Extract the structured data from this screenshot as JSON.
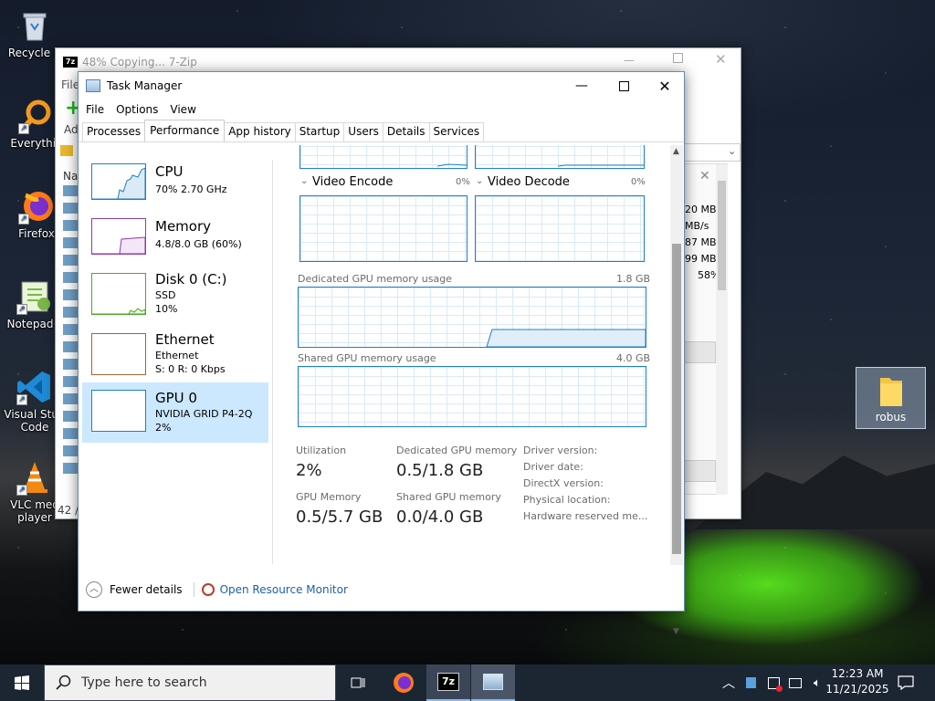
{
  "desktop": {
    "icons": [
      {
        "label": "Recycle B"
      },
      {
        "label": "Everythin"
      },
      {
        "label": "Firefox"
      },
      {
        "label": "Notepad+"
      },
      {
        "label": "Visual Stud Code"
      },
      {
        "label": "VLC med player"
      }
    ],
    "folder": {
      "label": "robus"
    }
  },
  "zip": {
    "title": "48% Copying... 7-Zip",
    "menu_file": "File",
    "add_label": "Ad",
    "list_header": "Nar",
    "status": "42 /",
    "stats": [
      "20 MB",
      "MB/s",
      "87 MB",
      "99 MB",
      "58%"
    ]
  },
  "tm": {
    "title": "Task Manager",
    "menu": [
      "File",
      "Options",
      "View"
    ],
    "tabs": [
      "Processes",
      "Performance",
      "App history",
      "Startup",
      "Users",
      "Details",
      "Services"
    ],
    "resources": [
      {
        "title": "CPU",
        "sub1": "70% 2.70 GHz",
        "sub2": "",
        "sub3": "",
        "color": "#1f7fc7"
      },
      {
        "title": "Memory",
        "sub1": "4.8/8.0 GB (60%)",
        "sub2": "",
        "sub3": "",
        "color": "#8b3da8"
      },
      {
        "title": "Disk 0 (C:)",
        "sub1": "SSD",
        "sub2": "10%",
        "sub3": "",
        "color": "#4da82b"
      },
      {
        "title": "Ethernet",
        "sub1": "Ethernet",
        "sub2": "S: 0 R: 0 Kbps",
        "sub3": "",
        "color": "#a6642b"
      },
      {
        "title": "GPU 0",
        "sub1": "NVIDIA GRID P4-2Q",
        "sub2": "2%",
        "sub3": "",
        "color": "#1f7fc7"
      }
    ],
    "engines": [
      {
        "name": "Video Encode",
        "pct": "0%"
      },
      {
        "name": "Video Decode",
        "pct": "0%"
      }
    ],
    "dedicated": {
      "label": "Dedicated GPU memory usage",
      "max": "1.8 GB"
    },
    "shared": {
      "label": "Shared GPU memory usage",
      "max": "4.0 GB"
    },
    "stats": {
      "utilization_label": "Utilization",
      "utilization": "2%",
      "dedicated_label": "Dedicated GPU memory",
      "dedicated": "0.5/1.8 GB",
      "gpumem_label": "GPU Memory",
      "gpumem": "0.5/5.7 GB",
      "shared_label": "Shared GPU memory",
      "shared": "0.0/4.0 GB"
    },
    "props": [
      "Driver version:",
      "Driver date:",
      "DirectX version:",
      "Physical location:",
      "Hardware reserved me..."
    ],
    "fewer": "Fewer details",
    "monitor": "Open Resource Monitor"
  },
  "taskbar": {
    "search_placeholder": "Type here to search",
    "time": "12:23 AM",
    "date": "11/21/2025"
  }
}
